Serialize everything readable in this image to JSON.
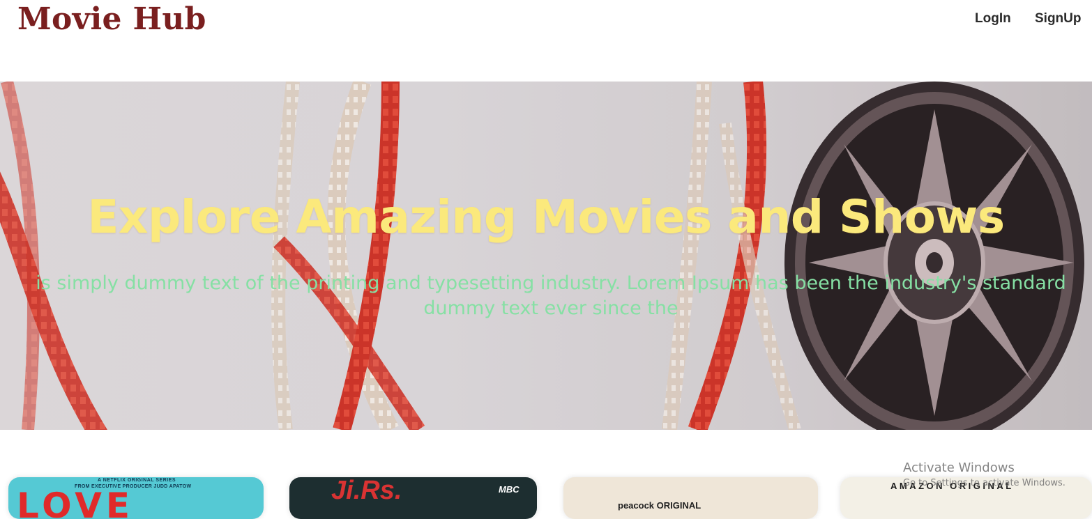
{
  "header": {
    "brand": "Movie Hub",
    "nav": {
      "login_label": "LogIn",
      "signup_label": "SignUp"
    }
  },
  "hero": {
    "title": "Explore Amazing Movies and Shows",
    "subtitle": "is simply dummy text of the printing and typesetting industry. Lorem Ipsum has been the industry's standard dummy text ever since the",
    "background_image": "film-reels-photo"
  },
  "cards": [
    {
      "top_text": "A NETFLIX ORIGINAL SERIES",
      "producer_text": "FROM EXECUTIVE PRODUCER JUDD APATOW",
      "poster_title": "LOVE"
    },
    {
      "poster_title": "Ji.Rs.",
      "network_logo": "MBC"
    },
    {
      "badge": "peacock ORIGINAL"
    },
    {
      "badge": "AMAZON ORIGINAL"
    }
  ],
  "system_overlay": {
    "title": "Activate Windows",
    "subtitle": "Go to Settings to activate Windows."
  },
  "colors": {
    "brand": "#7a1f1f",
    "hero_title": "#fbe97c",
    "hero_subtitle": "#86e0a4",
    "nav_text": "#2b2b2b"
  }
}
